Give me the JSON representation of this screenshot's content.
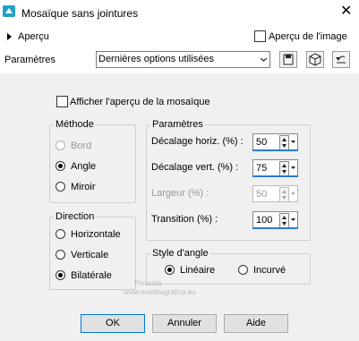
{
  "window": {
    "title": "Mosaïque sans jointures"
  },
  "header": {
    "preview_toggle": "Aperçu",
    "image_preview": "Aperçu de l'image",
    "params_label": "Paramètres"
  },
  "preset": {
    "selected": "Dernières options utilisées"
  },
  "options": {
    "tile_preview": "Afficher l'aperçu de la mosaïque"
  },
  "method": {
    "title": "Méthode",
    "items": [
      "Bord",
      "Angle",
      "Miroir"
    ],
    "selected": "Angle"
  },
  "direction": {
    "title": "Direction",
    "items": [
      "Horizontale",
      "Verticale",
      "Bilatérale"
    ],
    "selected": "Bilatérale"
  },
  "params": {
    "title": "Paramètres",
    "rows": [
      {
        "label": "Décalage horiz. (%) :",
        "value": "50"
      },
      {
        "label": "Décalage vert. (%) :",
        "value": "75"
      },
      {
        "label": "Largeur (%) :",
        "value": "50"
      },
      {
        "label": "Transition (%) :",
        "value": "100"
      }
    ]
  },
  "corner_style": {
    "title": "Style d'angle",
    "items": [
      "Linéaire",
      "Incurvé"
    ],
    "selected": "Linéaire"
  },
  "buttons": {
    "ok": "OK",
    "cancel": "Annuler",
    "help": "Aide"
  },
  "watermark": {
    "line1": "Pinuccia",
    "line2": "www.maidiragrafica.eu"
  }
}
